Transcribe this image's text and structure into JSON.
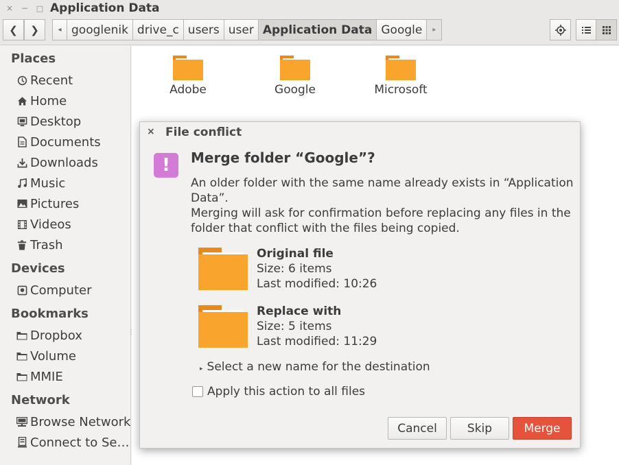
{
  "window": {
    "title": "Application Data",
    "close_glyph": "×",
    "minimize_glyph": "−",
    "maximize_glyph": "□"
  },
  "toolbar": {
    "back_glyph": "❮",
    "forward_glyph": "❯",
    "crumb_left_glyph": "◂",
    "crumb_right_glyph": "▸",
    "breadcrumbs": [
      "googlenik",
      "drive_c",
      "users",
      "user",
      "Application Data",
      "Google"
    ],
    "active_crumb": "Application Data"
  },
  "sidebar": {
    "sections": [
      {
        "title": "Places",
        "items": [
          {
            "label": "Recent",
            "icon": "clock-icon"
          },
          {
            "label": "Home",
            "icon": "home-icon"
          },
          {
            "label": "Desktop",
            "icon": "desktop-icon"
          },
          {
            "label": "Documents",
            "icon": "document-icon"
          },
          {
            "label": "Downloads",
            "icon": "download-icon"
          },
          {
            "label": "Music",
            "icon": "music-icon"
          },
          {
            "label": "Pictures",
            "icon": "picture-icon"
          },
          {
            "label": "Videos",
            "icon": "video-icon"
          },
          {
            "label": "Trash",
            "icon": "trash-icon"
          }
        ]
      },
      {
        "title": "Devices",
        "items": [
          {
            "label": "Computer",
            "icon": "drive-icon"
          }
        ]
      },
      {
        "title": "Bookmarks",
        "items": [
          {
            "label": "Dropbox",
            "icon": "folder-icon"
          },
          {
            "label": "Volume",
            "icon": "folder-icon"
          },
          {
            "label": "MMIE",
            "icon": "folder-icon"
          }
        ]
      },
      {
        "title": "Network",
        "items": [
          {
            "label": "Browse Network",
            "icon": "network-icon"
          },
          {
            "label": "Connect to Se…",
            "icon": "server-icon"
          }
        ]
      }
    ]
  },
  "files": [
    {
      "name": "Adobe",
      "icon": "folder-icon"
    },
    {
      "name": "Google",
      "icon": "folder-icon"
    },
    {
      "name": "Microsoft",
      "icon": "folder-icon"
    }
  ],
  "dialog": {
    "title": "File conflict",
    "close_glyph": "×",
    "warning_glyph": "!",
    "heading": "Merge folder “Google”?",
    "message1": "An older folder with the same name already exists in “Application Data”.",
    "message2": "Merging will ask for confirmation before replacing any files in the folder that conflict with the files being copied.",
    "original": {
      "label": "Original file",
      "size": "Size: 6 items",
      "modified": "Last modified: 10:26"
    },
    "replacement": {
      "label": "Replace with",
      "size": "Size: 5 items",
      "modified": "Last modified: 11:29"
    },
    "expander_glyph": "▸",
    "expander_label": "Select a new name for the destination",
    "apply_all_label": "Apply this action to all files",
    "apply_all_checked": false,
    "buttons": {
      "cancel": "Cancel",
      "skip": "Skip",
      "merge": "Merge"
    },
    "colors": {
      "merge_button": "#e5533d",
      "warning_icon": "#d37bd7",
      "folder": "#f9a52d"
    }
  }
}
